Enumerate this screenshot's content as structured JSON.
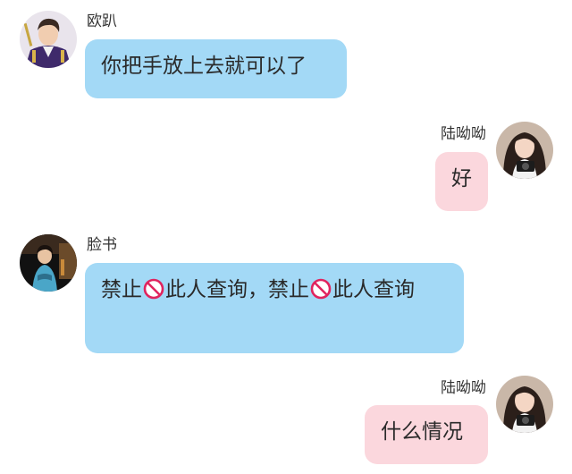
{
  "messages": [
    {
      "sender": "欧趴",
      "side": "left",
      "avatar": "man-in-purple-uniform-avatar",
      "bubble_color": "#a3d9f6",
      "text": "你把手放上去就可以了"
    },
    {
      "sender": "陆呦呦",
      "side": "right",
      "avatar": "girl-with-camera-avatar",
      "bubble_color": "#fbd7dd",
      "text": "好"
    },
    {
      "sender": "脸书",
      "side": "left",
      "avatar": "woman-on-stage-avatar",
      "bubble_color": "#a3d9f6",
      "text_parts": [
        "禁止",
        "此人查询，禁止",
        "此人查询"
      ],
      "inline_icon": "prohibited-icon"
    },
    {
      "sender": "陆呦呦",
      "side": "right",
      "avatar": "girl-with-camera-avatar",
      "bubble_color": "#fbd7dd",
      "text": "什么情况"
    }
  ]
}
